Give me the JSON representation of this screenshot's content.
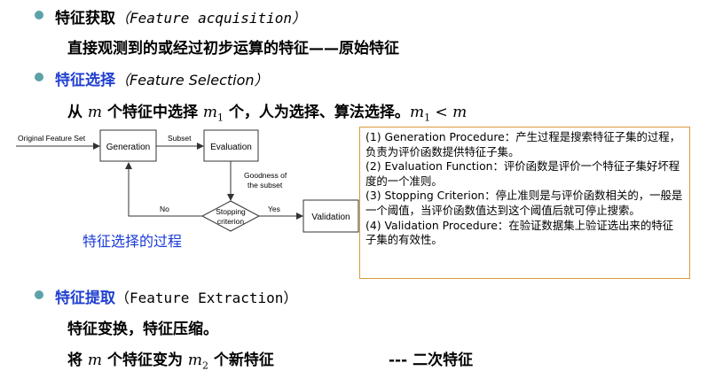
{
  "section1": {
    "title": "特征获取",
    "title_en": "（Feature acquisition）",
    "desc": "直接观测到的或经过初步运算的特征——原始特征"
  },
  "section2": {
    "title": "特征选择",
    "title_en": "（Feature Selection）",
    "desc_pre": "从",
    "desc_m": "m",
    "desc_mid": "个特征中选择",
    "desc_m1": "m",
    "desc_m1_sub": "1",
    "desc_post": "个，人为选择、算法选择。",
    "ineq_m": "m",
    "ineq_sub": "1",
    "ineq_rest": " < m"
  },
  "diagram": {
    "input_label": "Original Feature Set",
    "generation": "Generation",
    "subset_label": "Subset",
    "evaluation": "Evaluation",
    "goodness_line1": "Goodness of",
    "goodness_line2": "the subset",
    "stopping_line1": "Stopping",
    "stopping_line2": "criterion",
    "no_label": "No",
    "yes_label": "Yes",
    "validation": "Validation",
    "caption": "特征选择的过程"
  },
  "notes": [
    "(1) Generation Procedure：产生过程是搜索特征子集的过程，负责为评价函数提供特征子集。",
    "(2) Evaluation Function：评价函数是评价一个特征子集好坏程度的一个准则。",
    "(3) Stopping Criterion：停止准则是与评价函数相关的，一般是一个阈值，当评价函数值达到这个阈值后就可停止搜索。",
    "(4) Validation Procedure：在验证数据集上验证选出来的特征子集的有效性。"
  ],
  "section3": {
    "title": "特征提取",
    "title_en": "（Feature Extraction）",
    "desc1": "特征变换，特征压缩。",
    "desc2_pre": "将",
    "desc2_m": "m",
    "desc2_mid": "个特征变为",
    "desc2_m2": "m",
    "desc2_m2_sub": "2",
    "desc2_post": "个新特征",
    "desc2_tail": "---  二次特征"
  },
  "colors": {
    "bullet": "#5ba3a8",
    "blue_heading": "#1f3fd0",
    "caption_blue": "#1a3bd8",
    "note_border": "#d89a3c"
  }
}
